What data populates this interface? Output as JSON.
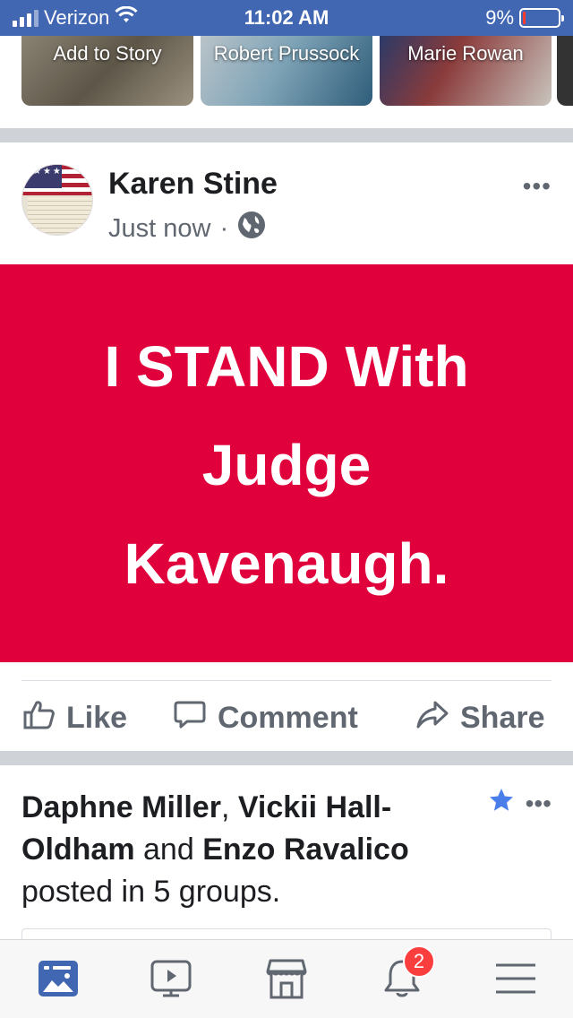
{
  "status_bar": {
    "carrier": "Verizon",
    "time": "11:02 AM",
    "battery_percent": "9%",
    "battery_level": 0.09,
    "battery_color": "#ff3b30",
    "wifi_icon": "wifi-icon"
  },
  "stories": [
    {
      "label": "Add to Story"
    },
    {
      "label": "Robert Prussock"
    },
    {
      "label": "Marie Rowan"
    }
  ],
  "post": {
    "author": "Karen Stine",
    "time": "Just now",
    "separator": "·",
    "privacy_icon": "globe-icon",
    "more_icon": "more-horizontal-icon",
    "banner_text": "I  STAND With\nJudge\nKavenaugh.",
    "banner_color": "#e0003c",
    "actions": {
      "like": "Like",
      "comment": "Comment",
      "share": "Share"
    }
  },
  "post2": {
    "name1": "Daphne Miller",
    "sep1": ", ",
    "name2": "Vickii Hall-Oldham",
    "sep2": " and ",
    "name3": "Enzo Ravalico",
    "suffix": "posted in 5 groups.",
    "star_icon": "star-icon",
    "more_icon": "more-horizontal-icon"
  },
  "tabbar": {
    "tabs": [
      {
        "icon": "news-feed-icon",
        "active": true
      },
      {
        "icon": "watch-video-icon"
      },
      {
        "icon": "marketplace-icon"
      },
      {
        "icon": "notifications-bell-icon",
        "badge": "2"
      },
      {
        "icon": "menu-icon"
      }
    ],
    "accent_color": "#4267b2"
  }
}
